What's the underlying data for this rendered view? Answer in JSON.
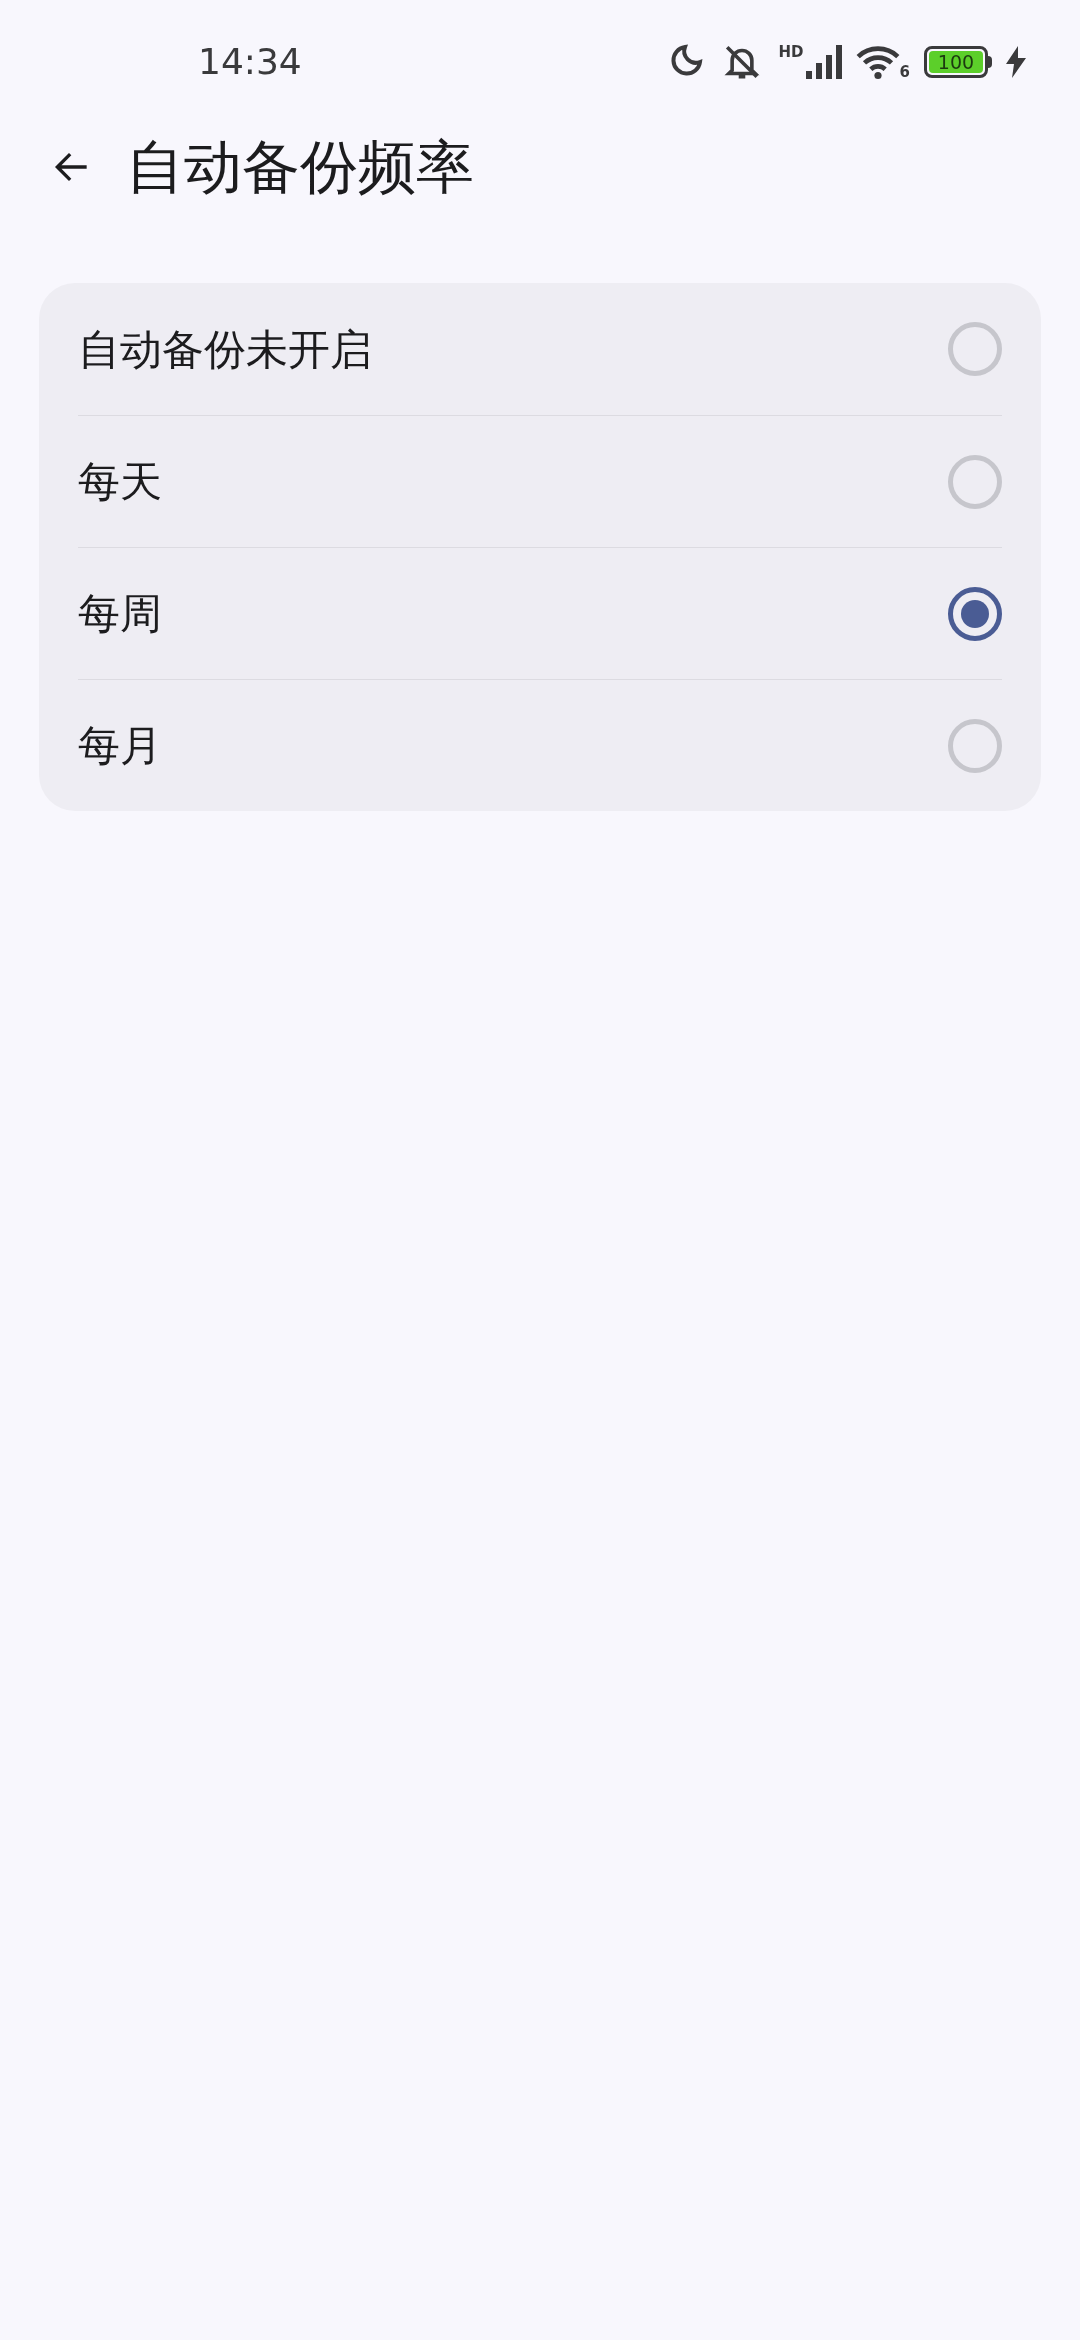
{
  "status_bar": {
    "time": "14:34",
    "hd_label": "HD",
    "wifi_generation": "6",
    "battery": "100"
  },
  "header": {
    "title": "自动备份频率"
  },
  "options": [
    {
      "label": "自动备份未开启",
      "selected": false
    },
    {
      "label": "每天",
      "selected": false
    },
    {
      "label": "每周",
      "selected": true
    },
    {
      "label": "每月",
      "selected": false
    }
  ]
}
